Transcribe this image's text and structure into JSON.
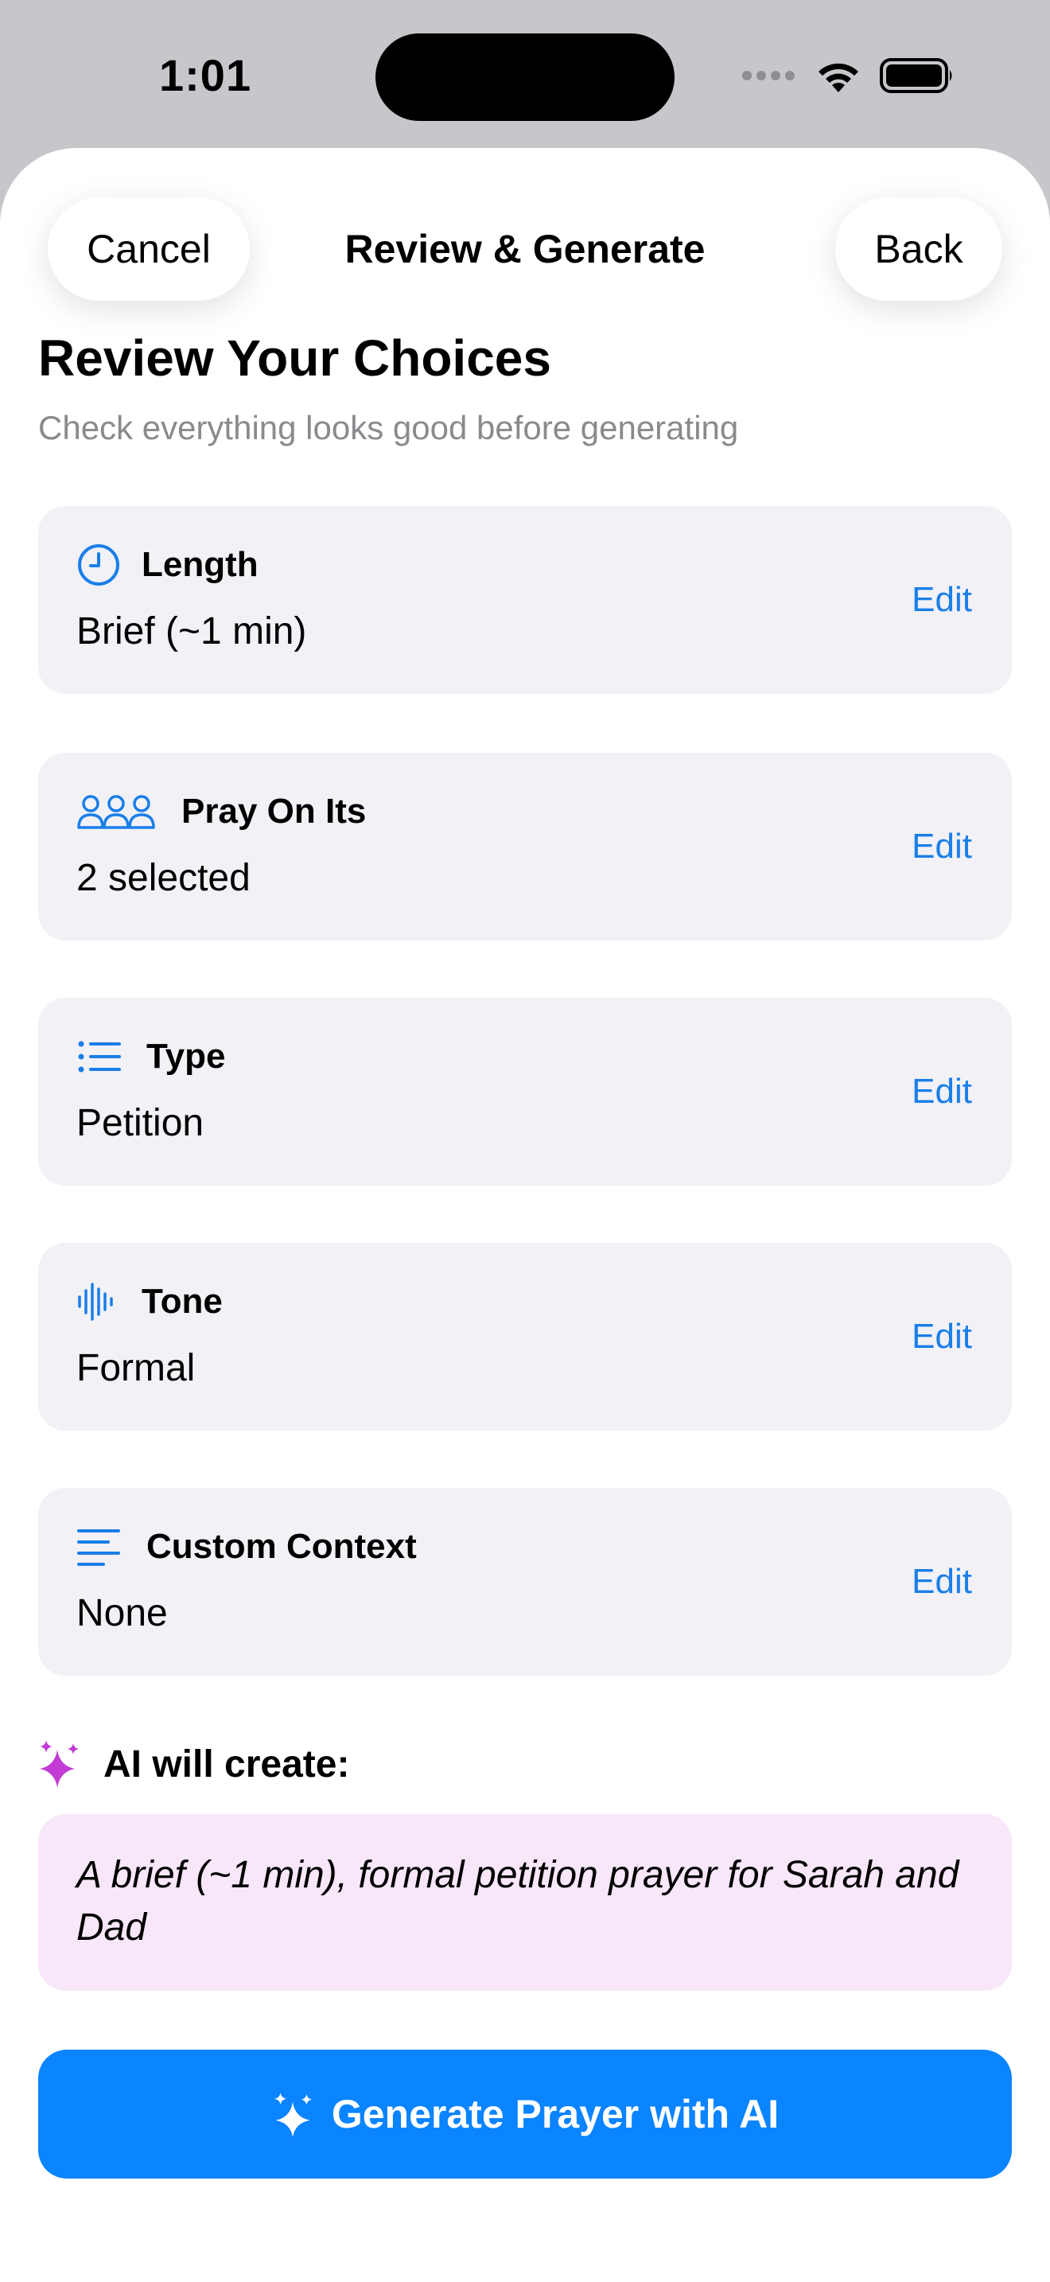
{
  "status_bar": {
    "time": "1:01"
  },
  "nav": {
    "cancel_label": "Cancel",
    "title": "Review & Generate",
    "back_label": "Back"
  },
  "header": {
    "title": "Review Your Choices",
    "subtitle": "Check everything looks good before generating"
  },
  "cards": [
    {
      "icon": "clock-icon",
      "title": "Length",
      "value": "Brief (~1 min)",
      "edit_label": "Edit"
    },
    {
      "icon": "people-icon",
      "title": "Pray On Its",
      "value": "2 selected",
      "edit_label": "Edit"
    },
    {
      "icon": "list-icon",
      "title": "Type",
      "value": "Petition",
      "edit_label": "Edit"
    },
    {
      "icon": "waveform-icon",
      "title": "Tone",
      "value": "Formal",
      "edit_label": "Edit"
    },
    {
      "icon": "text-align-icon",
      "title": "Custom Context",
      "value": "None",
      "edit_label": "Edit"
    }
  ],
  "ai_summary": {
    "label": "AI will create:",
    "text": "A brief (~1 min), formal petition prayer for Sarah and Dad"
  },
  "generate_button": {
    "label": "Generate Prayer with AI"
  },
  "colors": {
    "accent_blue": "#1a7ee8",
    "button_blue": "#0a84ff",
    "sparkle_purple": "#c23bd4",
    "ai_box_pink": "#f8e7f8",
    "card_gray": "#f1f1f6"
  }
}
